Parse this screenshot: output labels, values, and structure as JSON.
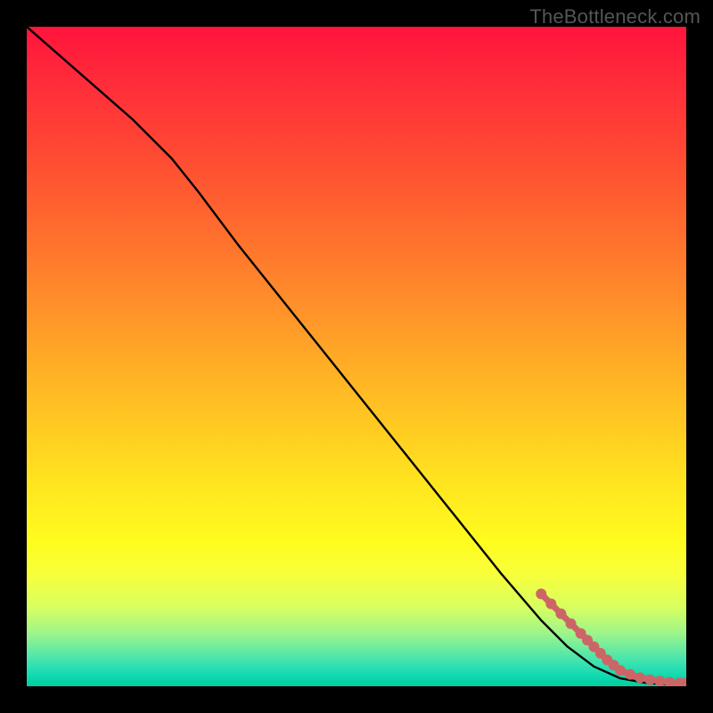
{
  "watermark": "TheBottleneck.com",
  "chart_data": {
    "type": "line",
    "title": "",
    "xlabel": "",
    "ylabel": "",
    "xlim": [
      0,
      100
    ],
    "ylim": [
      0,
      100
    ],
    "grid": false,
    "legend": false,
    "series": [
      {
        "name": "main-curve",
        "color": "#000000",
        "style": "solid",
        "x": [
          0,
          8,
          16,
          22,
          26,
          32,
          40,
          48,
          56,
          64,
          72,
          78,
          82,
          86,
          90,
          94,
          97,
          100
        ],
        "y": [
          100,
          93,
          86,
          80,
          75,
          67,
          57,
          47,
          37,
          27,
          17,
          10,
          6,
          3,
          1.2,
          0.5,
          0.3,
          0.2
        ]
      },
      {
        "name": "highlight-markers",
        "color": "#cc6666",
        "style": "markers",
        "x": [
          78,
          79.5,
          81,
          82.5,
          84,
          85,
          86,
          87,
          88,
          89,
          90,
          91.5,
          93,
          94.5,
          96,
          97.5,
          99,
          99.8
        ],
        "y": [
          14,
          12.5,
          11,
          9.5,
          8,
          7,
          6,
          5,
          4,
          3.2,
          2.4,
          1.8,
          1.3,
          1.0,
          0.8,
          0.6,
          0.5,
          0.45
        ]
      }
    ],
    "background_gradient": {
      "orientation": "vertical",
      "stops": [
        {
          "pos": 0.0,
          "color": "#ff143c"
        },
        {
          "pos": 0.5,
          "color": "#ffd023"
        },
        {
          "pos": 0.82,
          "color": "#fdff2a"
        },
        {
          "pos": 1.0,
          "color": "#00cf9e"
        }
      ]
    }
  }
}
